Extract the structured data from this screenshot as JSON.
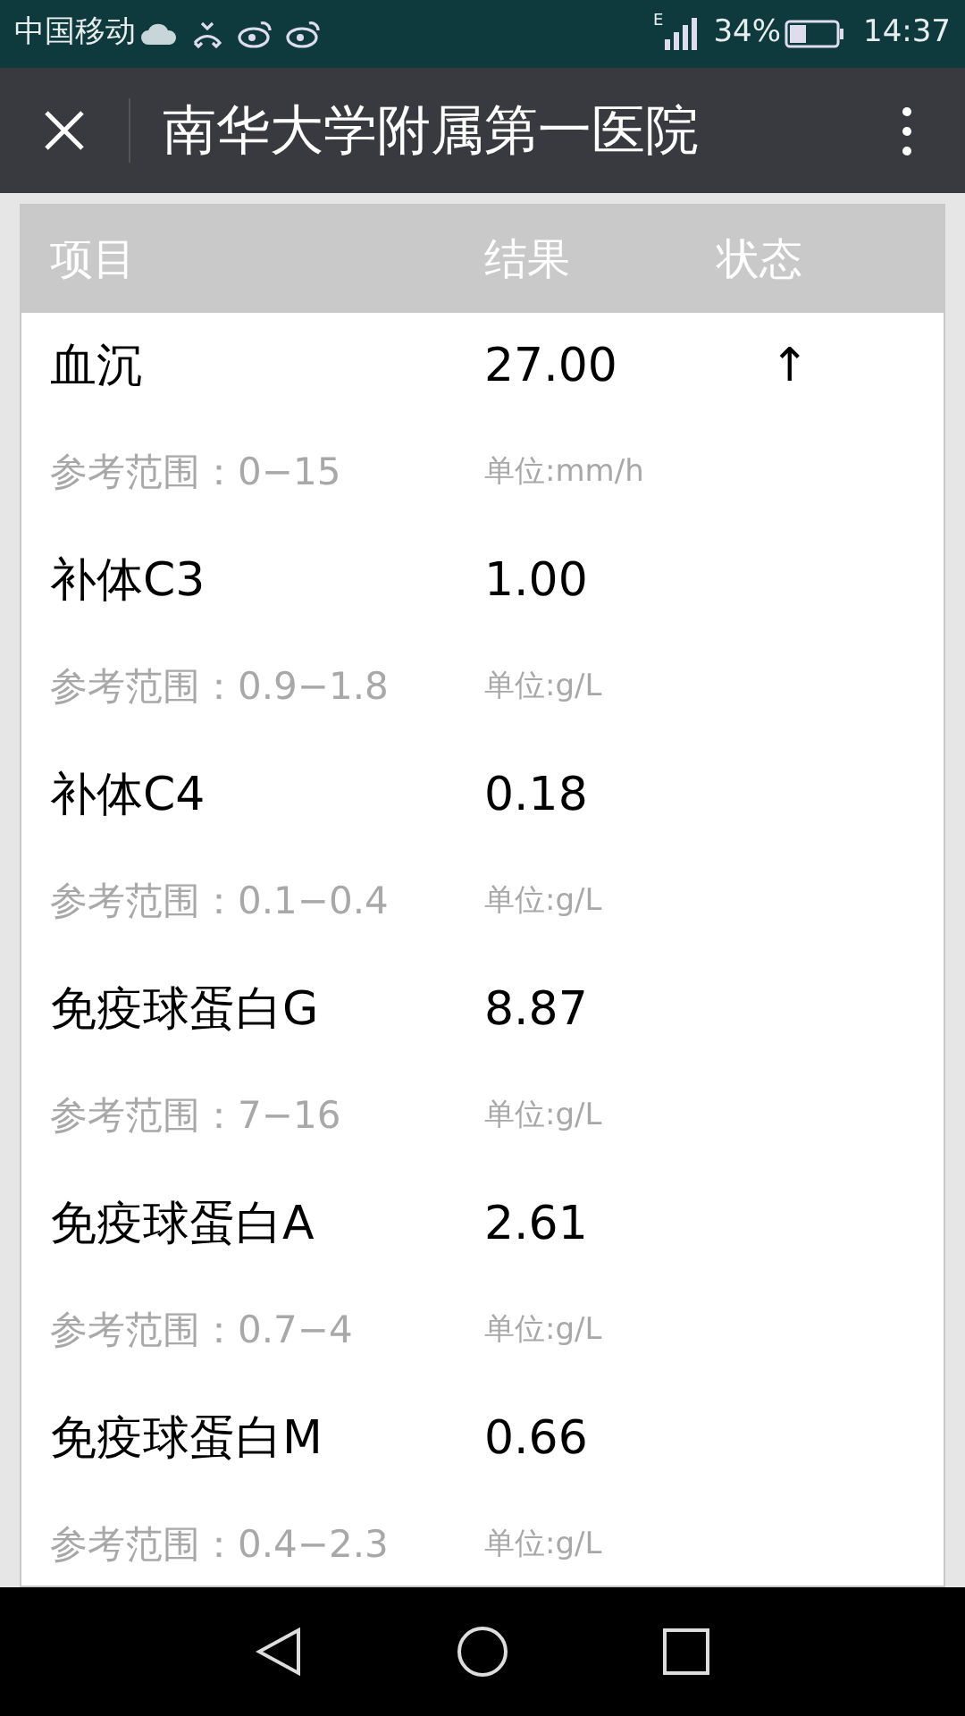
{
  "status_bar": {
    "carrier": "中国移动",
    "network": "E",
    "battery": "34%",
    "time": "14:37"
  },
  "title_bar": {
    "title": "南华大学附属第一医院"
  },
  "table": {
    "columns": [
      "项目",
      "结果",
      "状态"
    ],
    "rows": [
      {
        "item": "血沉",
        "result": "27.00",
        "status": "↑",
        "reference": "参考范围：0−15",
        "unit": "单位:mm/h"
      },
      {
        "item": "补体C3",
        "result": "1.00",
        "reference": "参考范围：0.9−1.8",
        "unit": "单位:g/L"
      },
      {
        "item": "补体C4",
        "result": "0.18",
        "reference": "参考范围：0.1−0.4",
        "unit": "单位:g/L"
      },
      {
        "item": "免疫球蛋白G",
        "result": "8.87",
        "reference": "参考范围：7−16",
        "unit": "单位:g/L"
      },
      {
        "item": "免疫球蛋白A",
        "result": "2.61",
        "reference": "参考范围：0.7−4",
        "unit": "单位:g/L"
      },
      {
        "item": "免疫球蛋白M",
        "result": "0.66",
        "reference": "参考范围：0.4−2.3",
        "unit": "单位:g/L"
      }
    ]
  }
}
